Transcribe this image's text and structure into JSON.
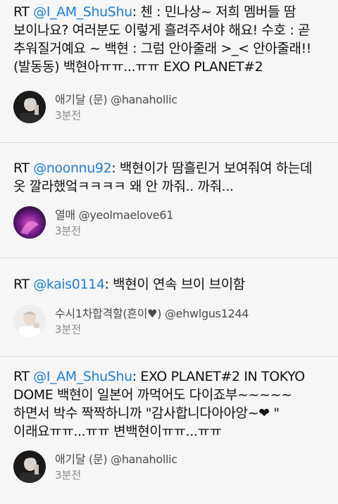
{
  "tweets": [
    {
      "prefix": "RT ",
      "mention": "@I_AM_ShuShu",
      "text": ": 첸 : 민나상~ 저희 멤버들 땀 보이나요? 여러분도 이렇게 흘려주셔야 해요! 수호 : 곧 추워질거예요 ~ 백현 : 그럼 안아줄래 >_< 안아줄래!! (발동동) 백현아ㅠㅠ...ㅠㅠ EXO PLANET#2",
      "author": "애기달 (문) @hanahollic",
      "time": "3분전",
      "avatar_icon": "dark-portrait-avatar"
    },
    {
      "prefix": "RT ",
      "mention": "@noonnu92",
      "text": ": 백현이가 땀흘린거 보여줘여 하는데 옷 깔라했엌ㅋㅋㅋㅋ 왜 안 까줘.. 까줘...",
      "author": "열매 @yeolmaelove61",
      "time": "3분전",
      "avatar_icon": "purple-glow-avatar"
    },
    {
      "prefix": "RT ",
      "mention": "@kais0114",
      "text": ": 백현이 연속 브이 브이함",
      "author": "수시1차합격할(흔이♥) @ehwlgus1244",
      "time": "3분전",
      "avatar_icon": "light-portrait-avatar"
    },
    {
      "prefix": "RT ",
      "mention": "@I_AM_ShuShu",
      "text": ": EXO PLANET#2 IN TOKYO DOME 백현이 일본어 까먹어도 다이죠부~~~~~ 하면서 박수 짝짝하니까 \"감사합니다아아앙~❤  \" 이래요ㅠㅠ...ㅠㅠ 변백현이ㅠㅠ...ㅠㅠ",
      "author": "애기달 (문) @hanahollic",
      "time": "3분전",
      "avatar_icon": "dark-portrait-avatar"
    }
  ]
}
